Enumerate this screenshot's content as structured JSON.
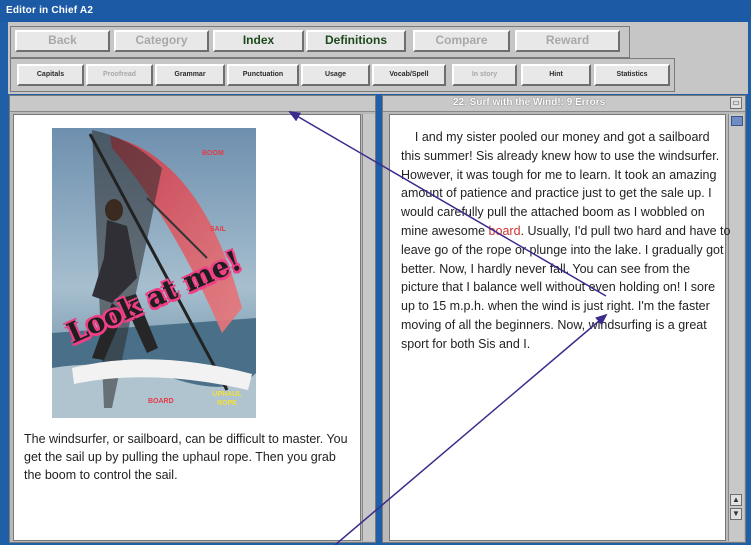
{
  "window": {
    "title": "Editor in Chief A2"
  },
  "toolbar": {
    "row1": [
      {
        "id": "back",
        "label": "Back",
        "enabled": false
      },
      {
        "id": "category",
        "label": "Category",
        "enabled": false
      },
      {
        "id": "index",
        "label": "Index",
        "enabled": true
      },
      {
        "id": "definitions",
        "label": "Definitions",
        "enabled": true
      },
      {
        "id": "compare",
        "label": "Compare",
        "enabled": false
      },
      {
        "id": "reward",
        "label": "Reward",
        "enabled": false
      }
    ],
    "row2": [
      {
        "id": "capitals",
        "label": "Capitals",
        "enabled": true
      },
      {
        "id": "proofread",
        "label": "Proofread",
        "enabled": false
      },
      {
        "id": "grammar",
        "label": "Grammar",
        "enabled": true
      },
      {
        "id": "punctuation",
        "label": "Punctuation",
        "enabled": true
      },
      {
        "id": "usage",
        "label": "Usage",
        "enabled": true
      },
      {
        "id": "vocabspell",
        "label": "Vocab/Spell",
        "enabled": true
      },
      {
        "id": "in-story",
        "label": "In story",
        "enabled": false
      },
      {
        "id": "hint",
        "label": "Hint",
        "enabled": true
      },
      {
        "id": "statistics",
        "label": "Statistics",
        "enabled": true
      }
    ]
  },
  "left_pane": {
    "photo_labels": {
      "label1": "BOOM",
      "label2": "SAIL",
      "label3": "BOARD",
      "label4": "UPHAUL ROPE",
      "overlay": "Look at me!"
    },
    "caption": "The windsurfer, or sailboard, can be difficult to master. You get the sail up by pulling the uphaul rope. Then you grab the boom to control the sail."
  },
  "right_pane": {
    "title": "22. Surf with the Wind!: 9 Errors",
    "story_before": "I and my sister pooled our money and got a sailboard this summer! Sis already knew how to use the windsurfer. However, it was tough for me to learn. It took an amazing amount of patience and practice just to get the sale up. I would carefully pull the attached boom as I wobbled on mine awesome ",
    "story_highlight": "board",
    "story_after": ". Usually, I'd pull two hard and have to leave go of the rope or plunge into the lake. I gradually got better. Now, I hardly never fall. You can see from the picture that I balance well without even holding on! I sore up to 15 m.p.h. when the wind is just right. I'm the faster moving of all the beginners. Now, windsurfing is a great sport for both Sis and I."
  },
  "scrollbar": {
    "up": "▲",
    "down": "▼"
  },
  "colors": {
    "title_bar": "#1d5aa6",
    "arrow": "#3a2b8c",
    "error_text": "#d23434",
    "scroll_thumb": "#6f8dc4"
  },
  "icons": {
    "arrow": "arrow-pointer-icon"
  }
}
